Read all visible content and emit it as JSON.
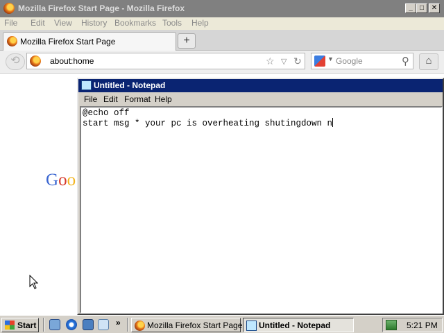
{
  "firefox": {
    "title": "Mozilla Firefox Start Page - Mozilla Firefox",
    "window_buttons": {
      "minimize": "_",
      "maximize": "□",
      "close": "✕"
    },
    "menu": [
      "File",
      "Edit",
      "View",
      "History",
      "Bookmarks",
      "Tools",
      "Help"
    ],
    "tab_label": "Mozilla Firefox Start Page",
    "new_tab": "+",
    "url": "about:home",
    "search_placeholder": "Google",
    "logo_partial": {
      "g": "G",
      "o1": "o",
      "o2": "o"
    },
    "icons": [
      "firefox-icon",
      "back-icon",
      "star-icon",
      "dropdown-icon",
      "reload-icon",
      "google-icon",
      "search-icon",
      "home-icon"
    ]
  },
  "notepad": {
    "title": "Untitled - Notepad",
    "menu": [
      "File",
      "Edit",
      "Format",
      "Help"
    ],
    "line1": "@echo off",
    "line2": "start msg * your pc is overheating shutingdown n"
  },
  "taskbar": {
    "start_label": "Start",
    "chevron": "»",
    "tasks": [
      {
        "label": "Mozilla Firefox Start Page -...",
        "active": false
      },
      {
        "label": "Untitled - Notepad",
        "active": true
      }
    ],
    "clock": "5:21 PM"
  },
  "colors": {
    "inactive_title": "#808080",
    "active_title": "#0a2472",
    "taskbar": "#d4d0c8"
  }
}
